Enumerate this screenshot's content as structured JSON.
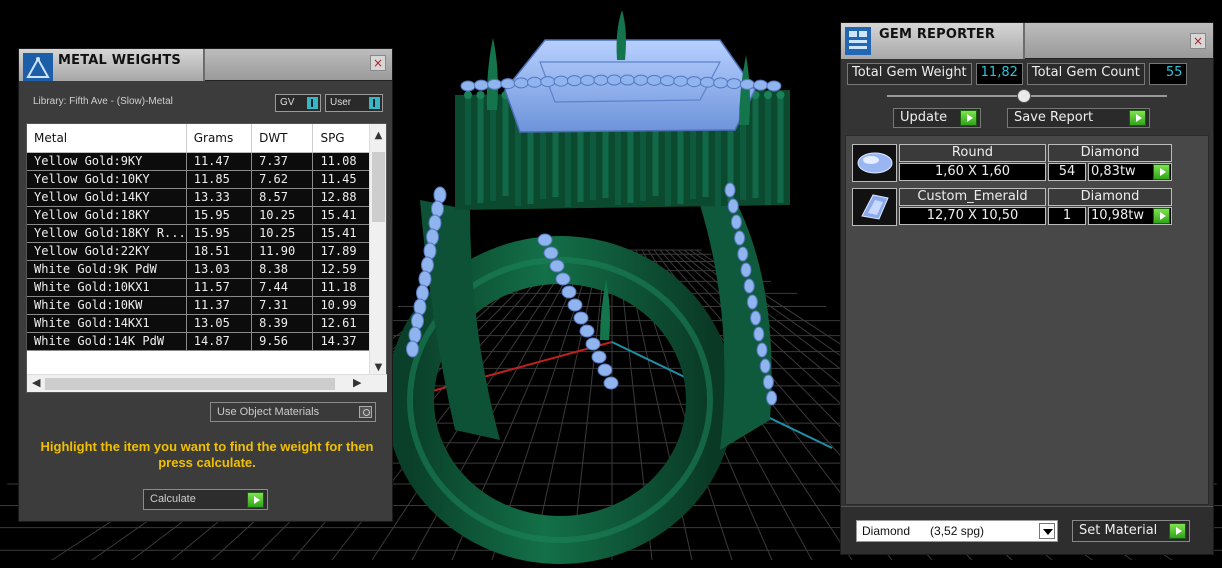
{
  "metal_weights": {
    "title": "METAL WEIGHTS",
    "close": "×",
    "library_label": "Library: Fifth Ave - (Slow)-Metal",
    "toggle_gv": "GV",
    "toggle_user": "User",
    "columns": [
      "Metal",
      "Grams",
      "DWT",
      "SPG"
    ],
    "rows": [
      [
        "Yellow Gold:9KY",
        "11.47",
        "7.37",
        "11.08"
      ],
      [
        "Yellow Gold:10KY",
        "11.85",
        "7.62",
        "11.45"
      ],
      [
        "Yellow Gold:14KY",
        "13.33",
        "8.57",
        "12.88"
      ],
      [
        "Yellow Gold:18KY",
        "15.95",
        "10.25",
        "15.41"
      ],
      [
        "Yellow Gold:18KY R...",
        "15.95",
        "10.25",
        "15.41"
      ],
      [
        "Yellow Gold:22KY",
        "18.51",
        "11.90",
        "17.89"
      ],
      [
        "White Gold:9K PdW",
        "13.03",
        "8.38",
        "12.59"
      ],
      [
        "White Gold:10KX1",
        "11.57",
        "7.44",
        "11.18"
      ],
      [
        "White Gold:10KW",
        "11.37",
        "7.31",
        "10.99"
      ],
      [
        "White Gold:14KX1",
        "13.05",
        "8.39",
        "12.61"
      ],
      [
        "White Gold:14K PdW",
        "14.87",
        "9.56",
        "14.37"
      ]
    ],
    "use_object_materials": "Use Object Materials",
    "hint": "Highlight the item you want to find the weight for then press calculate.",
    "calculate": "Calculate"
  },
  "gem_reporter": {
    "title": "GEM REPORTER",
    "close": "×",
    "total_weight_label": "Total Gem Weight",
    "total_weight_value": "11,82",
    "total_count_label": "Total Gem Count",
    "total_count_value": "55",
    "update": "Update",
    "save_report": "Save Report",
    "gems": [
      {
        "shape": "Round",
        "material": "Diamond",
        "size": "1,60 X 1,60",
        "count": "54",
        "weight": "0,83tw"
      },
      {
        "shape": "Custom_Emerald",
        "material": "Diamond",
        "size": "12,70 X 10,50",
        "count": "1",
        "weight": "10,98tw"
      }
    ],
    "material_select": "Diamond      (3,52 spg)",
    "set_material": "Set Material"
  },
  "colors": {
    "ring": "#0f5a3c",
    "stones": "#8fb4ee",
    "accent_value": "#2fc3d8",
    "hint_text": "#f0c000",
    "play_green": "#3fbf22"
  }
}
